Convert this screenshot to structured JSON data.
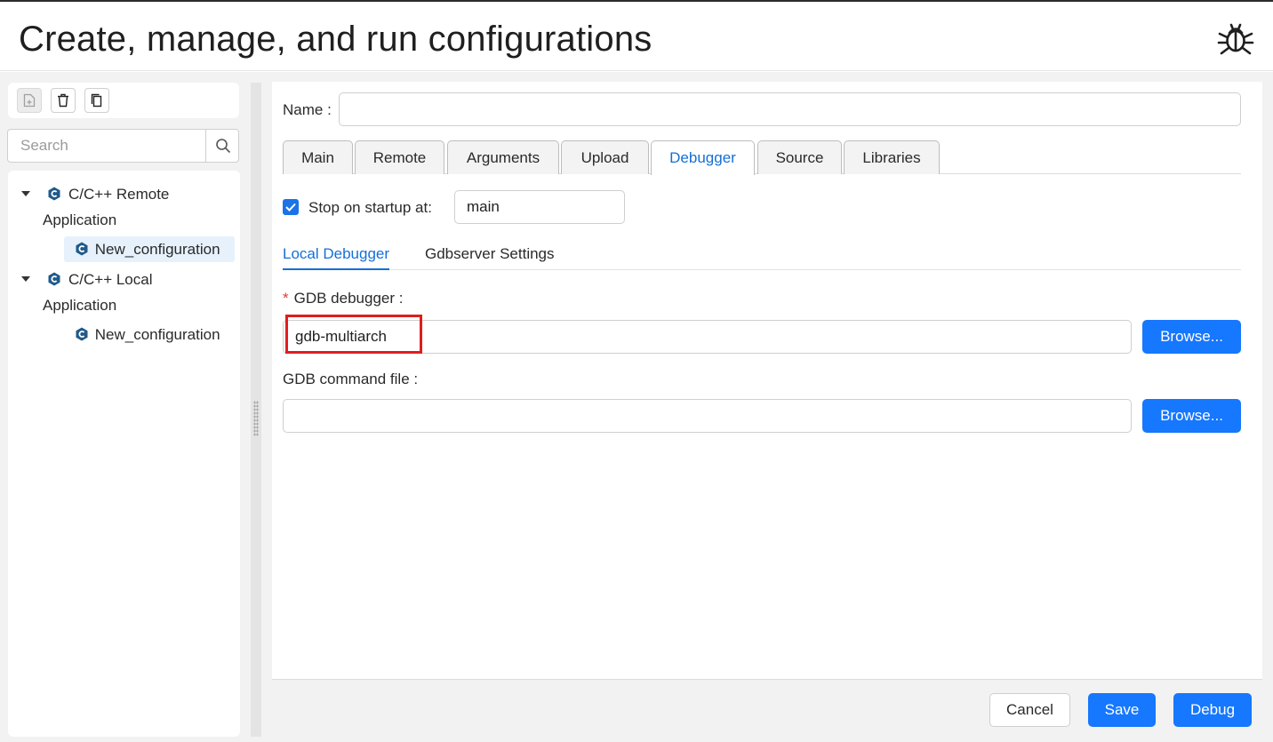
{
  "header": {
    "title": "Create, manage, and run configurations",
    "icon": "bug-icon"
  },
  "sidebar": {
    "toolbar": {
      "new_icon": "new-file-icon",
      "delete_icon": "trash-icon",
      "copy_icon": "copy-icon"
    },
    "search": {
      "placeholder": "Search",
      "icon": "search-icon"
    },
    "tree": [
      {
        "label_line1": "C/C++ Remote",
        "label_line2": "Application",
        "children": [
          "New_configuration"
        ],
        "expanded": true
      },
      {
        "label_line1": "C/C++ Local",
        "label_line2": "Application",
        "children": [
          "New_configuration"
        ],
        "expanded": true
      }
    ]
  },
  "form": {
    "name_label": "Name",
    "name_value": "",
    "tabs": [
      "Main",
      "Remote",
      "Arguments",
      "Upload",
      "Debugger",
      "Source",
      "Libraries"
    ],
    "active_tab": "Debugger",
    "stop_on_startup": {
      "checked": true,
      "label": "Stop on startup at:",
      "value": "main"
    },
    "subtabs": [
      "Local Debugger",
      "Gdbserver Settings"
    ],
    "active_subtab": "Local Debugger",
    "gdb_debugger": {
      "required_mark": "*",
      "label": "GDB debugger",
      "value": "gdb-multiarch",
      "browse": "Browse..."
    },
    "gdb_command_file": {
      "label": "GDB command file",
      "value": "",
      "browse": "Browse..."
    }
  },
  "footer": {
    "cancel": "Cancel",
    "save": "Save",
    "debug": "Debug"
  },
  "colors": {
    "accent": "#1677ff",
    "highlight_box": "#e01d1d",
    "active_tab_text": "#1470d6"
  }
}
